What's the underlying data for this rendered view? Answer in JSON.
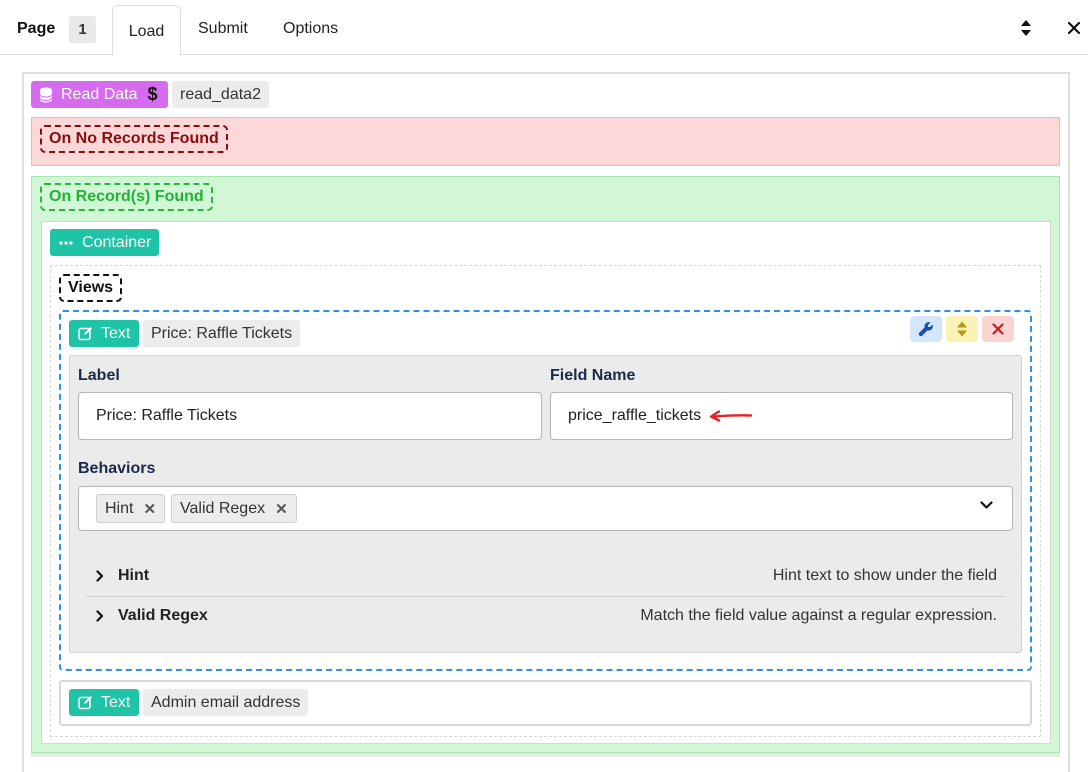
{
  "header": {
    "page_label": "Page",
    "page_number": "1",
    "tabs": [
      {
        "label": "Load",
        "active": true
      },
      {
        "label": "Submit",
        "active": false
      },
      {
        "label": "Options",
        "active": false
      }
    ],
    "icons": [
      "sort-icon",
      "close-icon"
    ]
  },
  "read_data": {
    "badge_label": "Read Data",
    "icon_left": "database-icon",
    "icon_right": "dollar-icon",
    "name": "read_data2"
  },
  "no_records": {
    "label": "On No Records Found"
  },
  "records_found": {
    "label": "On Record(s) Found"
  },
  "container": {
    "badge_label": "Container",
    "icon": "ellipsis-icon"
  },
  "views": {
    "label": "Views"
  },
  "field1": {
    "type_label": "Text",
    "icon": "edit-icon",
    "title": "Price: Raffle Tickets",
    "label_heading": "Label",
    "label_value": "Price: Raffle Tickets",
    "fieldname_heading": "Field Name",
    "fieldname_value": "price_raffle_tickets",
    "behaviors_heading": "Behaviors",
    "behaviors": [
      "Hint",
      "Valid Regex"
    ],
    "rows": [
      {
        "title": "Hint",
        "desc": "Hint text to show under the field"
      },
      {
        "title": "Valid Regex",
        "desc": "Match the field value against a regular expression."
      }
    ],
    "action_icons": [
      "wrench-icon",
      "sort-icon",
      "delete-icon"
    ]
  },
  "field2": {
    "type_label": "Text",
    "icon": "edit-icon",
    "title": "Admin email address"
  },
  "colors": {
    "purple": "#d66bf0",
    "teal": "#1fc4a7",
    "red_bg": "#fdd8d8",
    "green_bg": "#d2f7d6",
    "blue_dash": "#2f8fea",
    "arrow": "#e32222"
  }
}
